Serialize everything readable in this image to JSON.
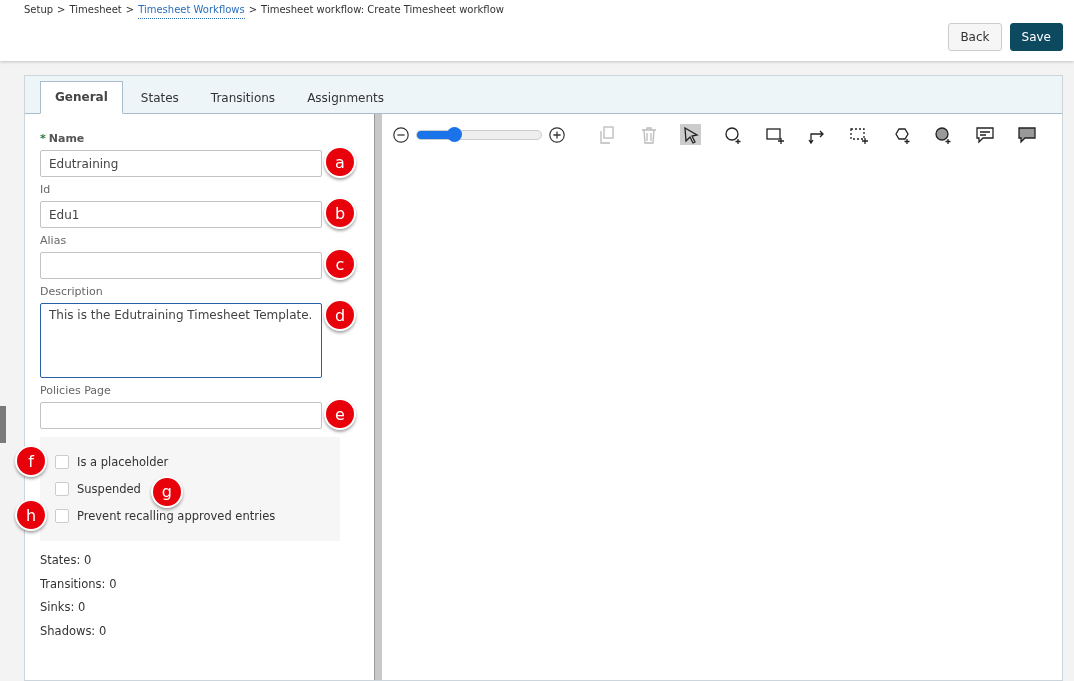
{
  "breadcrumb_separator": ">",
  "breadcrumb": [
    {
      "label": "Setup",
      "link": false
    },
    {
      "label": "Timesheet",
      "link": false
    },
    {
      "label": "Timesheet Workflows",
      "link": true
    },
    {
      "label": "Timesheet workflow: Create Timesheet workflow",
      "link": false
    }
  ],
  "header_buttons": [
    {
      "label": "Back",
      "kind": "secondary"
    },
    {
      "label": "Save",
      "kind": "primary"
    }
  ],
  "tabs": [
    {
      "label": "General",
      "selected": true
    },
    {
      "label": "States",
      "selected": false
    },
    {
      "label": "Transitions",
      "selected": false
    },
    {
      "label": "Assignments",
      "selected": false
    }
  ],
  "fields": [
    {
      "label": "Name",
      "required_mark": "*",
      "value": "Edutraining",
      "kind": "input",
      "focused": false,
      "marker": "a"
    },
    {
      "label": "Id",
      "value": "Edu1",
      "kind": "input",
      "focused": false,
      "marker": "b"
    },
    {
      "label": "Alias",
      "kind": "input",
      "focused": false,
      "marker": "c"
    },
    {
      "label": "Description",
      "value": "This is the Edutraining Timesheet Template.",
      "kind": "textarea",
      "focused": true,
      "marker": "d"
    },
    {
      "label": "Policies Page",
      "kind": "input",
      "focused": false,
      "marker": "e"
    }
  ],
  "checkboxes": [
    {
      "label": "Is a placeholder",
      "checked": false,
      "marker": "f",
      "marker_after_label": false
    },
    {
      "label": "Suspended",
      "checked": false,
      "marker": "g",
      "marker_after_label": true
    },
    {
      "label": "Prevent recalling approved entries",
      "checked": false,
      "marker": "h",
      "marker_after_label": false
    }
  ],
  "stats": [
    "States: 0",
    "Transitions: 0",
    "Sinks: 0",
    "Shadows: 0"
  ],
  "zoom": {
    "level": 0.3
  },
  "tools": [
    {
      "kind": "copy",
      "disabled": true,
      "selected": false
    },
    {
      "kind": "trash",
      "disabled": true,
      "selected": false
    },
    {
      "kind": "pointer",
      "disabled": false,
      "selected": true
    },
    {
      "kind": "circle",
      "disabled": false,
      "selected": false
    },
    {
      "kind": "rect",
      "disabled": false,
      "selected": false
    },
    {
      "kind": "connector",
      "disabled": false,
      "selected": false
    },
    {
      "kind": "dashed-rect",
      "disabled": false,
      "selected": false
    },
    {
      "kind": "hexagon",
      "disabled": false,
      "selected": false
    },
    {
      "kind": "shaded-circle",
      "disabled": false,
      "selected": false
    },
    {
      "kind": "comment",
      "disabled": false,
      "selected": false
    },
    {
      "kind": "shaded-comment",
      "disabled": false,
      "selected": false
    }
  ]
}
